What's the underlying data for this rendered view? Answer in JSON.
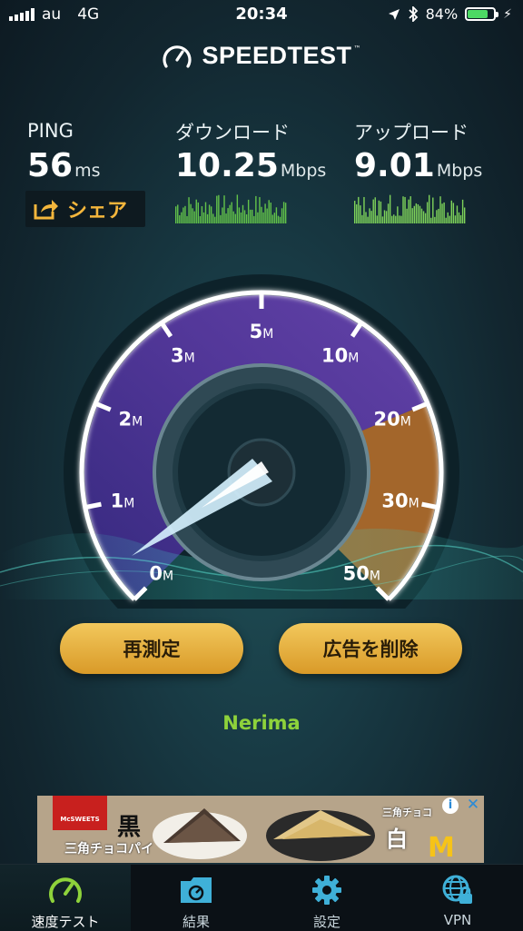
{
  "status": {
    "carrier": "au",
    "network": "4G",
    "time": "20:34",
    "battery": "84%",
    "battery_level": 0.84
  },
  "app": {
    "title": "SPEEDTEST"
  },
  "stats": {
    "ping_label": "PING",
    "ping_value": "56",
    "ping_unit": "ms",
    "download_label": "ダウンロード",
    "download_value": "10.25",
    "download_unit": "Mbps",
    "upload_label": "アップロード",
    "upload_value": "9.01",
    "upload_unit": "Mbps"
  },
  "share": {
    "label": "シェア"
  },
  "gauge": {
    "ticks": [
      "0",
      "1",
      "2",
      "3",
      "5",
      "10",
      "20",
      "30",
      "50"
    ],
    "tick_unit": "M",
    "needle_value": "0"
  },
  "actions": {
    "retest_label": "再測定",
    "remove_ads_label": "広告を削除"
  },
  "server": {
    "name": "Nerima"
  },
  "ad": {
    "brand": "McSWEETS",
    "text_black": "黒",
    "text_black_sub": "三角チョコパイ",
    "text_white": "白",
    "text_white_sub": "三角チョコ"
  },
  "tabs": [
    {
      "label": "速度テスト",
      "icon": "speedometer-icon",
      "active": true
    },
    {
      "label": "結果",
      "icon": "results-folder-icon",
      "active": false
    },
    {
      "label": "設定",
      "icon": "gear-icon",
      "active": false
    },
    {
      "label": "VPN",
      "icon": "vpn-globe-lock-icon",
      "active": false
    }
  ],
  "colors": {
    "accent_gold": "#f2c85c",
    "server_green": "#8ed23b",
    "gauge_purple": "#5a3fa8",
    "gauge_orange": "#e0892e"
  }
}
